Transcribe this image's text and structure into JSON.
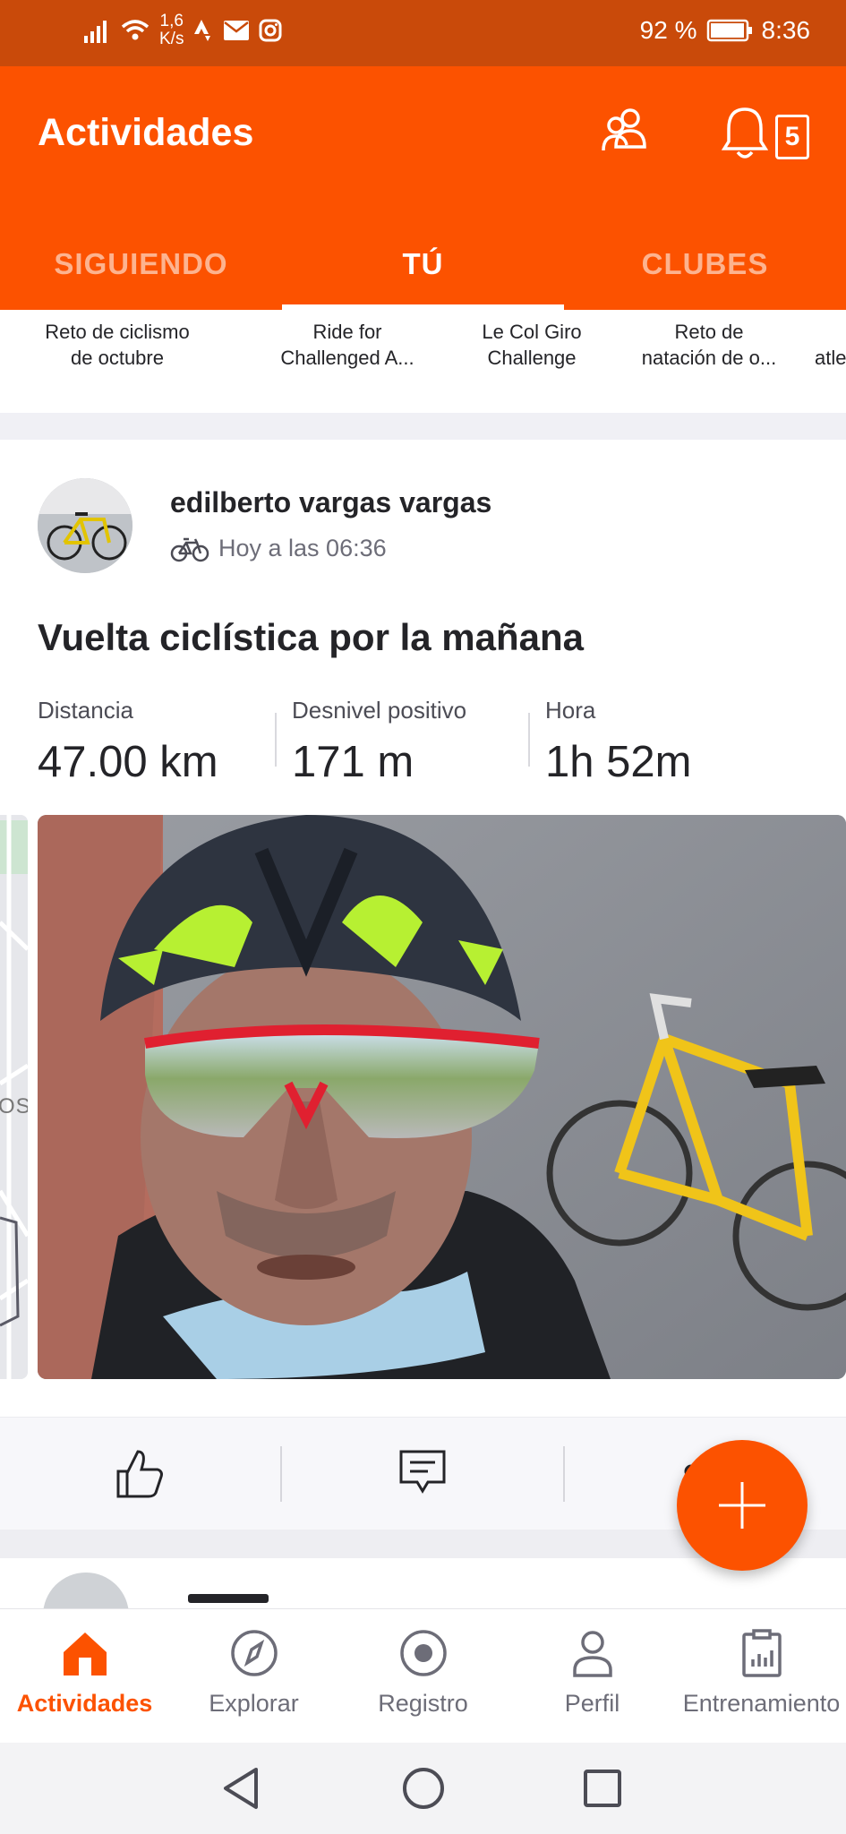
{
  "status_bar": {
    "network_speed_value": "1,6",
    "network_speed_unit": "K/s",
    "battery": "92 %",
    "time": "8:36"
  },
  "header": {
    "title": "Actividades",
    "notification_count": "5",
    "tabs": [
      {
        "label": "SIGUIENDO",
        "active": false
      },
      {
        "label": "TÚ",
        "active": true
      },
      {
        "label": "CLUBES",
        "active": false
      }
    ]
  },
  "challenges": [
    {
      "line1": "Reto de ciclismo",
      "line2": "de octubre"
    },
    {
      "line1": "Ride for",
      "line2": "Challenged A..."
    },
    {
      "line1": "Le Col Giro",
      "line2": "Challenge"
    },
    {
      "line1": "Reto de",
      "line2": "natación de o..."
    },
    {
      "line1": "atle",
      "line2": ""
    }
  ],
  "post": {
    "athlete_name": "edilberto vargas vargas",
    "timestamp": "Hoy a las 06:36",
    "activity_icon": "bike-icon",
    "title": "Vuelta ciclística por la mañana",
    "stats": [
      {
        "label": "Distancia",
        "value": "47.00 km"
      },
      {
        "label": "Desnivel positivo",
        "value": "171 m"
      },
      {
        "label": "Hora",
        "value": "1h 52m"
      }
    ],
    "map_peek_text": "OS"
  },
  "bottom_nav": [
    {
      "label": "Actividades",
      "icon": "home-icon",
      "active": true
    },
    {
      "label": "Explorar",
      "icon": "compass-icon",
      "active": false
    },
    {
      "label": "Registro",
      "icon": "record-icon",
      "active": false
    },
    {
      "label": "Perfil",
      "icon": "person-icon",
      "active": false
    },
    {
      "label": "Entrenamiento",
      "icon": "clipboard-chart-icon",
      "active": false
    }
  ],
  "colors": {
    "brand": "#fc5200",
    "status_bar": "#c94a0a",
    "text_primary": "#242428",
    "text_secondary": "#6d6d78"
  }
}
